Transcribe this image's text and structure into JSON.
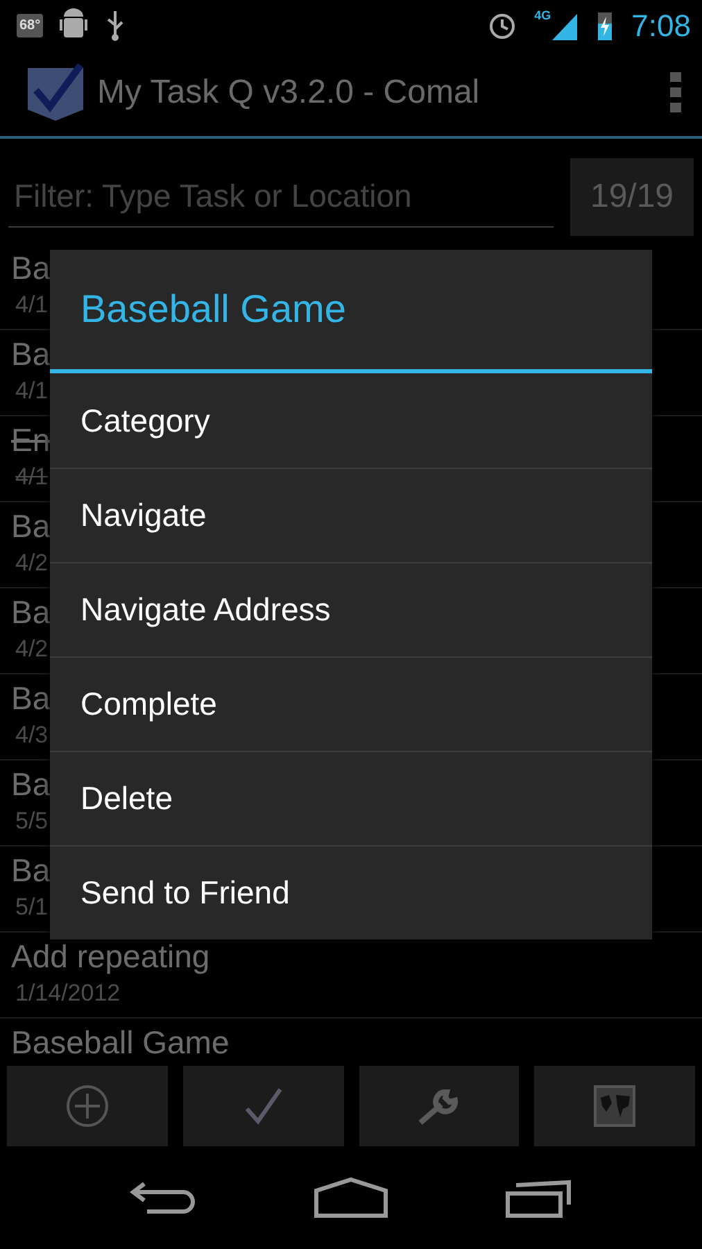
{
  "status_bar": {
    "temperature": "68°",
    "network": "4G",
    "time": "7:08"
  },
  "app_bar": {
    "title": "My Task Q v3.2.0 - Comal"
  },
  "filter": {
    "placeholder": "Filter: Type Task or Location",
    "count": "19/19"
  },
  "tasks": [
    {
      "title": "Ba",
      "date": "4/1",
      "completed": false
    },
    {
      "title": "Ba",
      "date": "4/1",
      "completed": false
    },
    {
      "title": "En",
      "date": "4/1",
      "completed": true
    },
    {
      "title": "Ba",
      "date": "4/2",
      "completed": false
    },
    {
      "title": "Ba",
      "date": "4/2",
      "completed": false
    },
    {
      "title": "Ba",
      "date": "4/3",
      "completed": false
    },
    {
      "title": "Ba",
      "date": "5/5",
      "completed": false
    },
    {
      "title": "Ba",
      "date": "5/1",
      "completed": false
    },
    {
      "title": "Add repeating",
      "date": "1/14/2012",
      "completed": false
    },
    {
      "title": "Baseball Game",
      "completed": false
    }
  ],
  "dialog": {
    "title": "Baseball Game",
    "items": [
      "Category",
      "Navigate",
      "Navigate Address",
      "Complete",
      "Delete",
      "Send to Friend"
    ]
  },
  "toolbar": [
    {
      "kind": "add"
    },
    {
      "kind": "check"
    },
    {
      "kind": "wrench"
    },
    {
      "kind": "map"
    }
  ]
}
